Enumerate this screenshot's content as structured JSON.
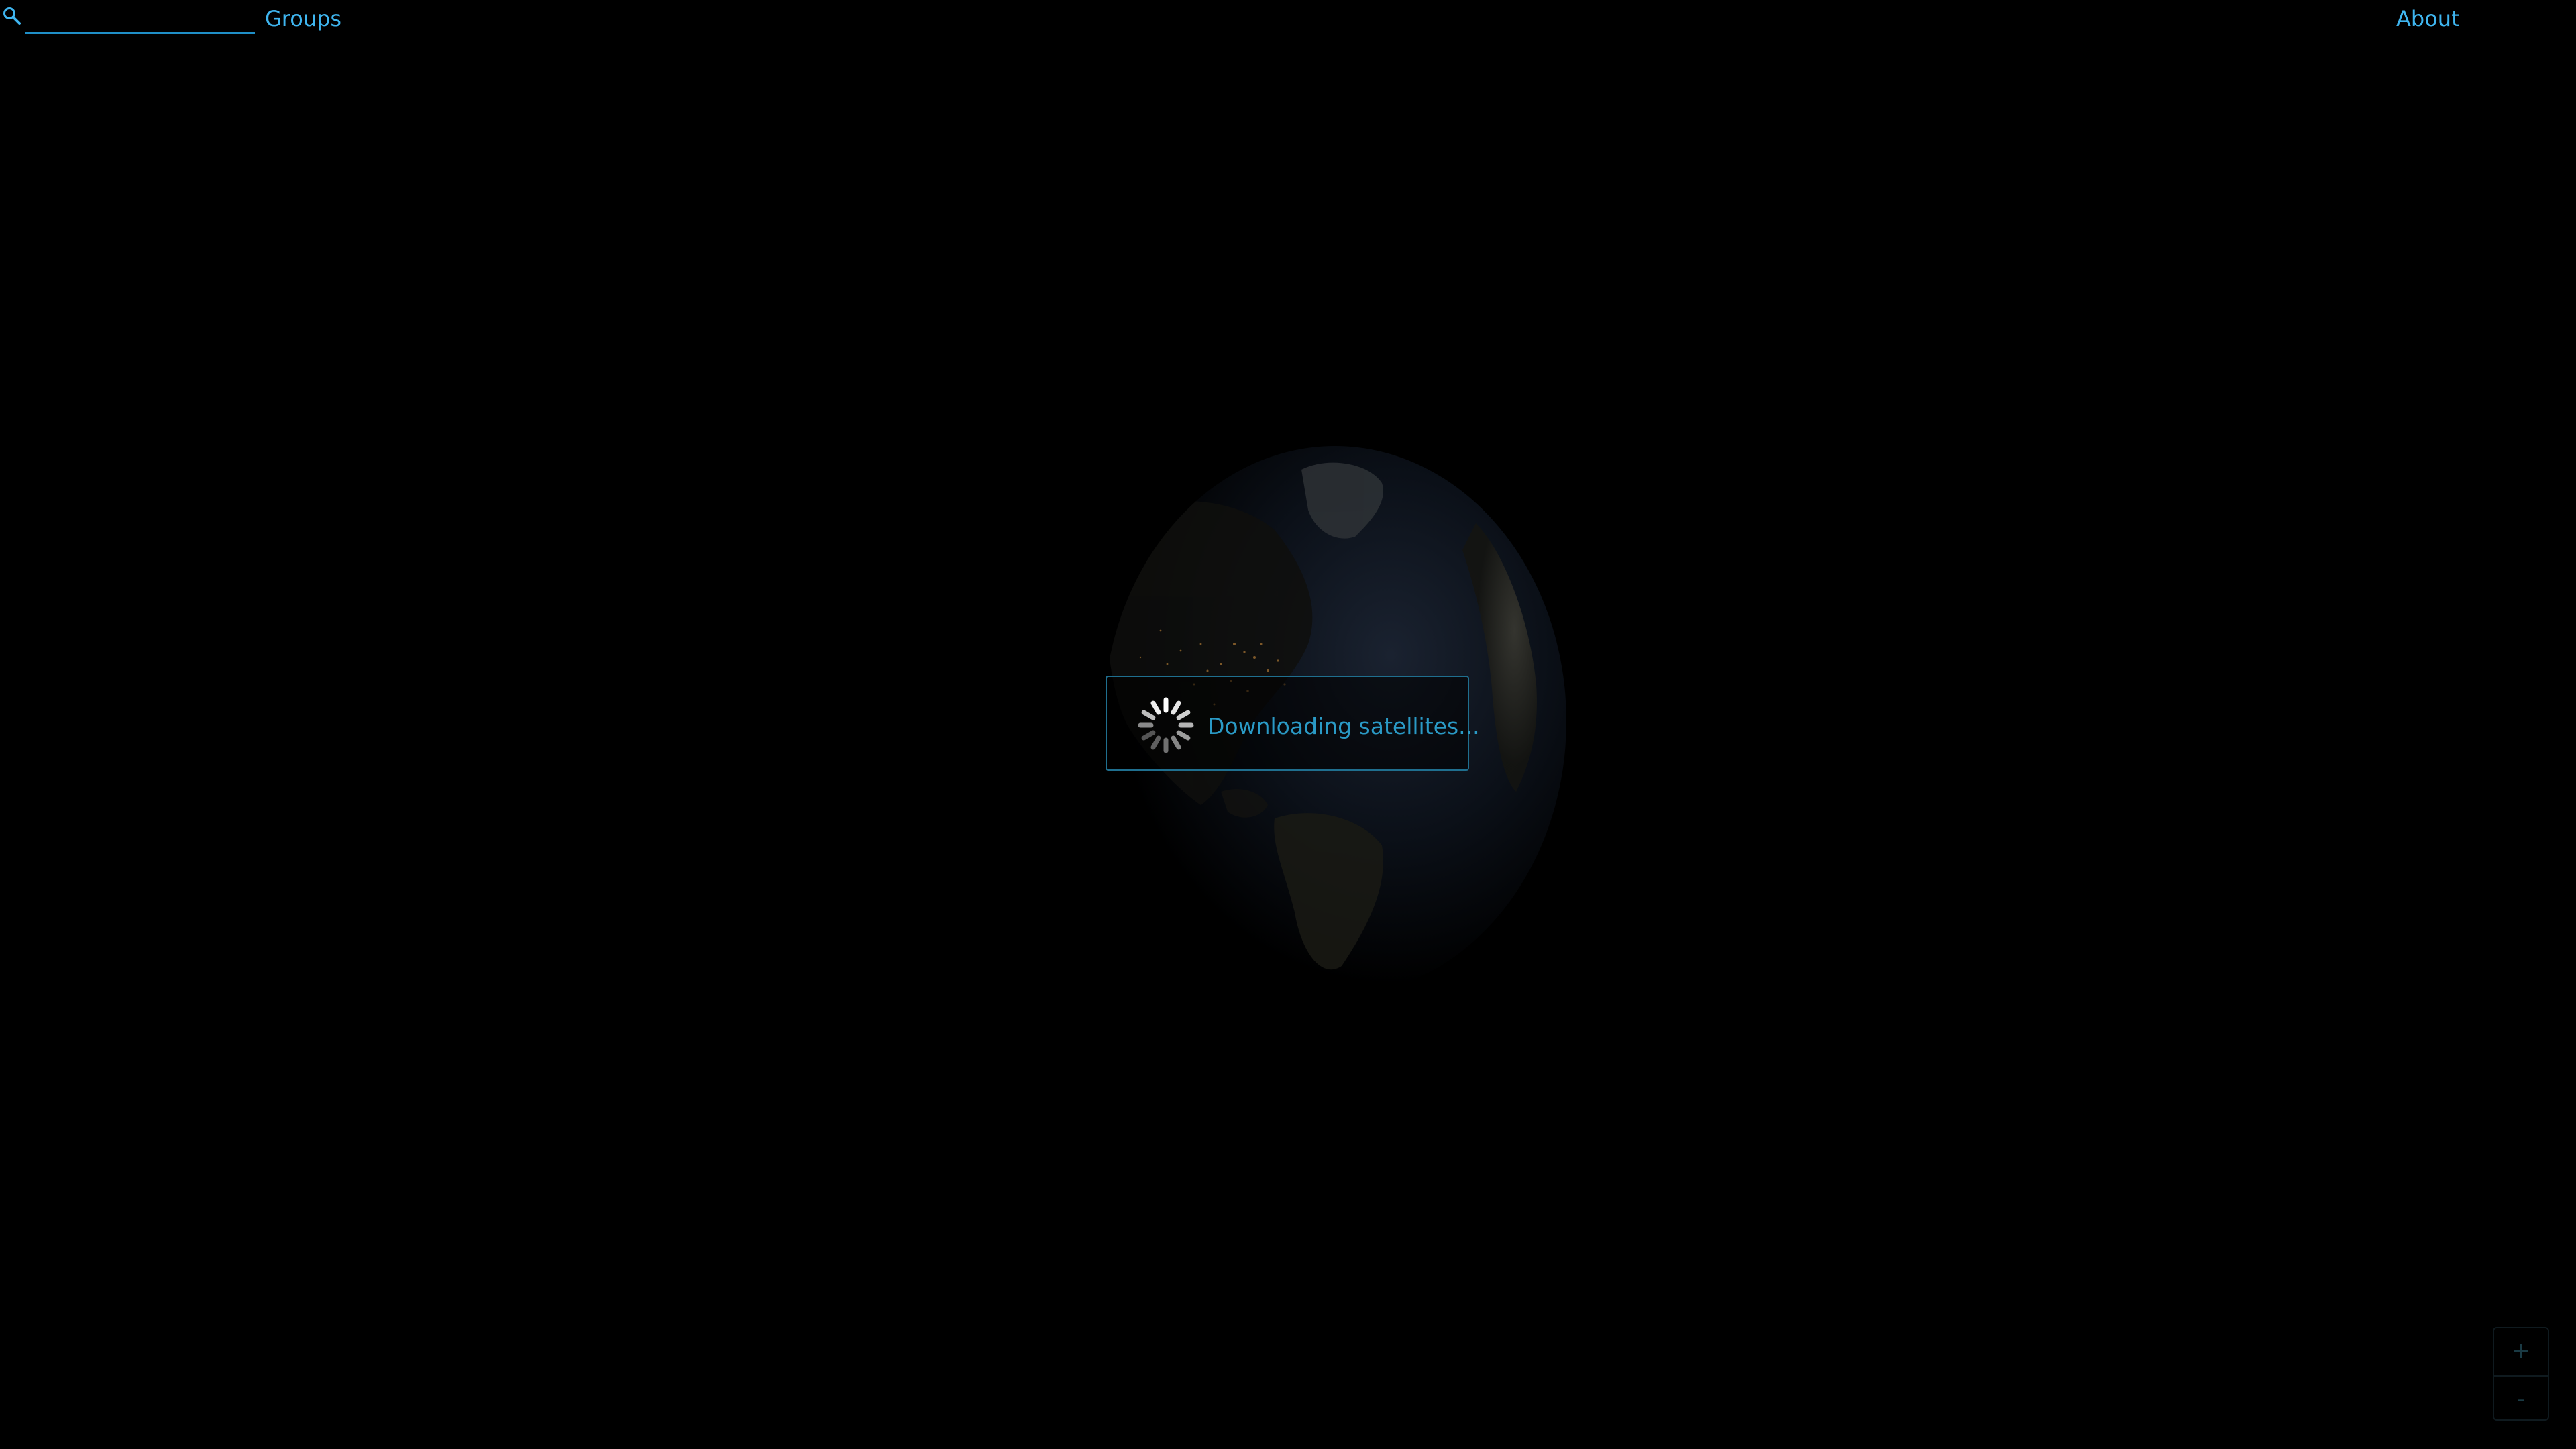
{
  "toolbar": {
    "search_value": "",
    "search_placeholder": "",
    "search_icon": "search-icon",
    "groups_label": "Groups",
    "about_label": "About"
  },
  "loading": {
    "message": "Downloading satellites...",
    "spinner_icon": "spinner-icon"
  },
  "zoom": {
    "in_label": "+",
    "out_label": "-"
  },
  "colors": {
    "background": "#000000",
    "accent": "#3fb6f0",
    "loader_border": "#1f6f8f",
    "loader_text": "#2a9ac6"
  }
}
